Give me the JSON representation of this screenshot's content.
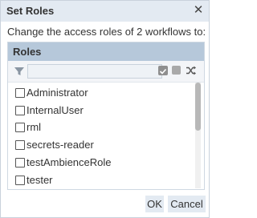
{
  "dialog": {
    "title": "Set Roles",
    "close_icon": "close-icon",
    "message": "Change the access roles of 2 workflows to:"
  },
  "panel": {
    "header": "Roles",
    "filter_icon": "filter-icon",
    "filter_value": "",
    "tools": {
      "check_all_icon": "check-all-icon",
      "uncheck_all_icon": "uncheck-all-icon",
      "toggle_icon": "shuffle-icon"
    }
  },
  "roles": [
    {
      "label": "Administrator",
      "checked": false
    },
    {
      "label": "InternalUser",
      "checked": false
    },
    {
      "label": "rml",
      "checked": false
    },
    {
      "label": "secrets-reader",
      "checked": false
    },
    {
      "label": "testAmbienceRole",
      "checked": false
    },
    {
      "label": "tester",
      "checked": false
    }
  ],
  "buttons": {
    "ok": "OK",
    "cancel": "Cancel"
  },
  "colors": {
    "titlebar": "#e3eaf2",
    "panel_header": "#b6c8da",
    "button_bg": "#e3eaf2",
    "text": "#333333"
  }
}
